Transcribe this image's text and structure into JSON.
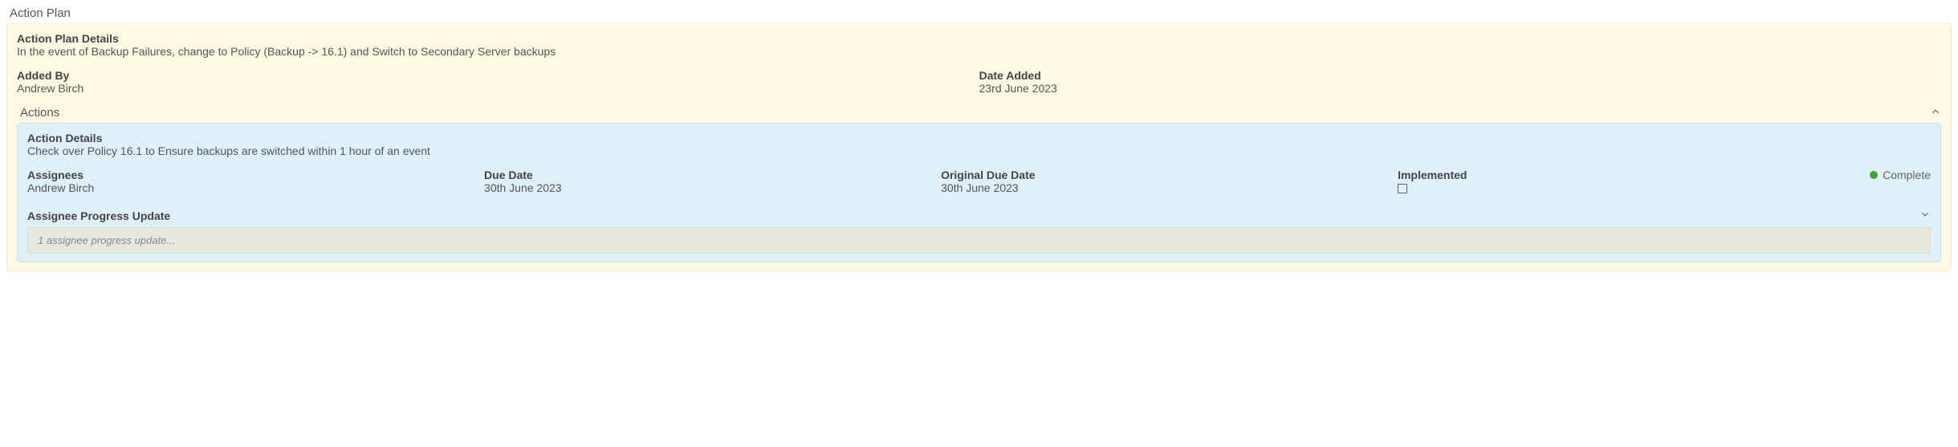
{
  "title": "Action Plan",
  "plan": {
    "details_label": "Action Plan Details",
    "details_text": "In the event of Backup Failures, change to Policy (Backup -> 16.1) and Switch to Secondary Server backups",
    "added_by_label": "Added By",
    "added_by_value": "Andrew Birch",
    "date_added_label": "Date Added",
    "date_added_value": "23rd June 2023"
  },
  "actions_label": "Actions",
  "action": {
    "details_label": "Action Details",
    "details_text": "Check over Policy 16.1 to Ensure backups are switched within 1 hour of an event",
    "assignees_label": "Assignees",
    "assignees_value": "Andrew Birch",
    "due_label": "Due Date",
    "due_value": "30th June 2023",
    "orig_due_label": "Original Due Date",
    "orig_due_value": "30th June 2023",
    "implemented_label": "Implemented",
    "status_text": "Complete",
    "progress_label": "Assignee Progress Update",
    "progress_summary": "1 assignee progress update..."
  }
}
